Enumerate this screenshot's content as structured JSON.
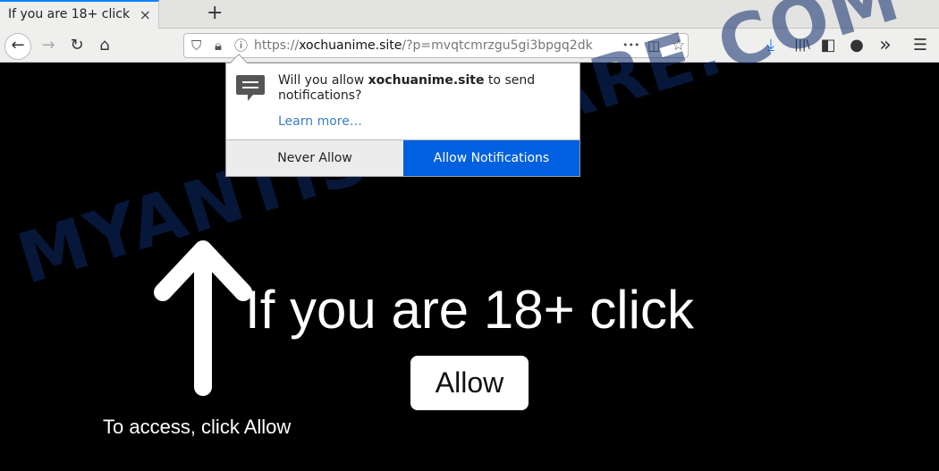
{
  "tab": {
    "title": "If you are 18+ click",
    "close": "×",
    "new_tab": "+"
  },
  "nav": {
    "back": "←",
    "forward": "→",
    "reload": "↻",
    "home": "⌂",
    "url_scheme": "https://",
    "url_host": "xochuanime.site",
    "url_path": "/?p=mvqtcmrzgu5gi3bpgq2dk",
    "more": "•••",
    "pocket": "◫",
    "star": "☆",
    "download": "⤓",
    "library": "|||\\",
    "sidebar": "◧",
    "account": "●",
    "overflow": "»",
    "menu": "☰"
  },
  "popup": {
    "msg_pre": "Will you allow ",
    "msg_site": "xochuanime.site",
    "msg_post": " to send notifications?",
    "learn_more": "Learn more…",
    "never": "Never Allow",
    "allow": "Allow Notifications"
  },
  "page": {
    "headline": "If you are 18+ click",
    "allow_button": "Allow",
    "hint": "To access, click Allow"
  },
  "watermark": "MYANTISPYWARE.COM",
  "colors": {
    "accent": "#0060df",
    "tab_line": "#0a84ff"
  }
}
